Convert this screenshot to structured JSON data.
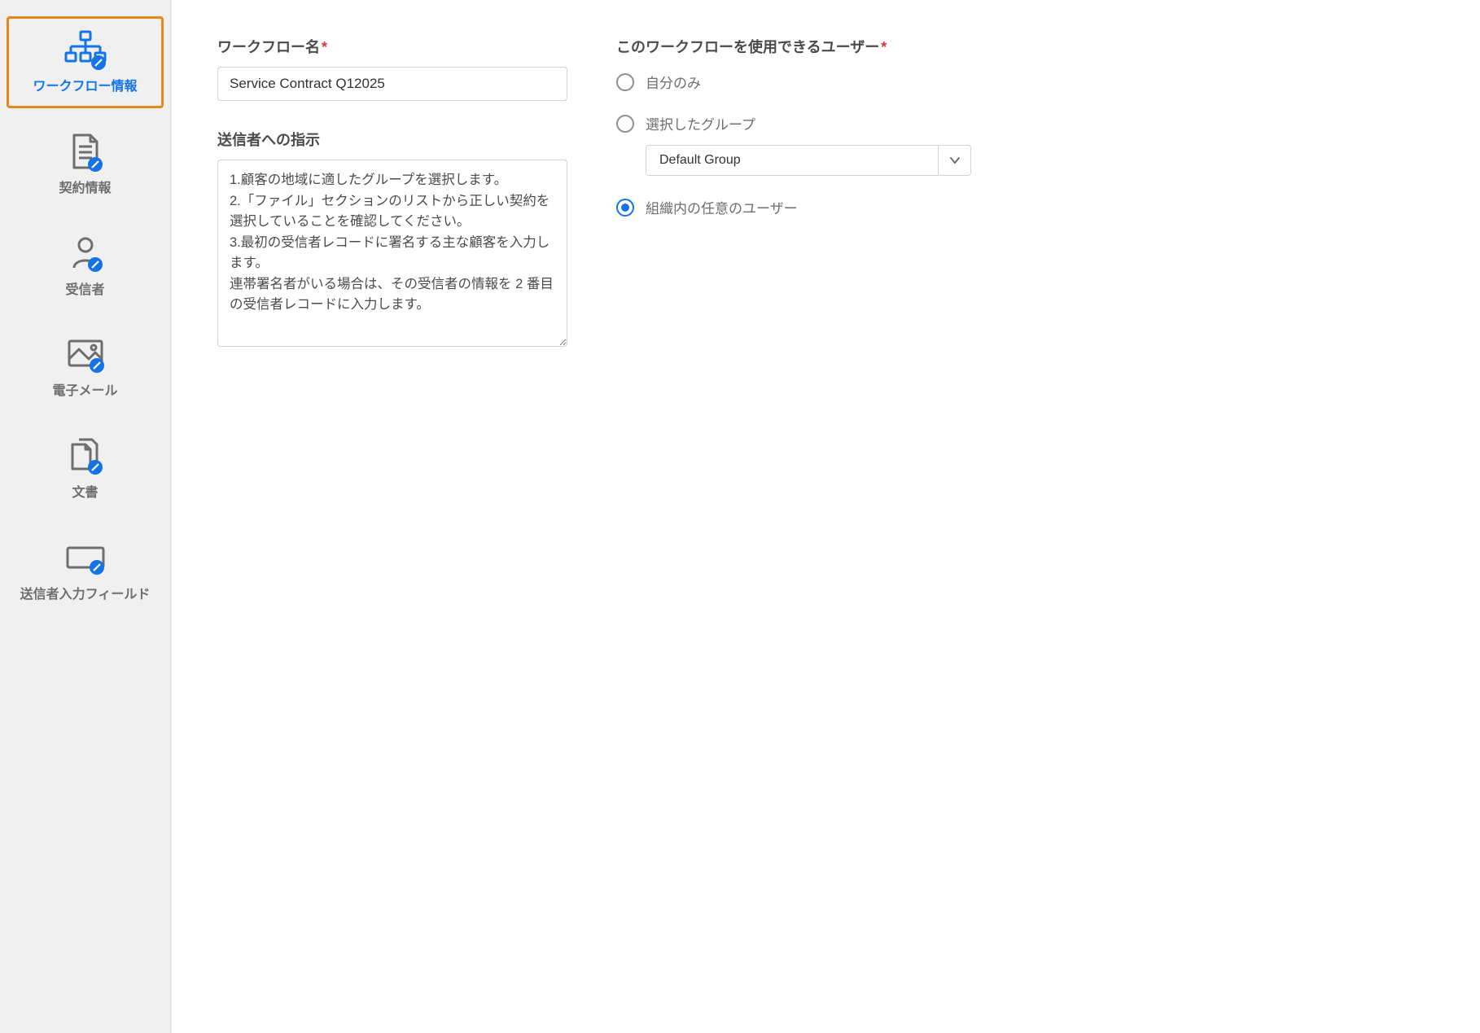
{
  "sidebar": {
    "items": [
      {
        "label": "ワークフロー情報"
      },
      {
        "label": "契約情報"
      },
      {
        "label": "受信者"
      },
      {
        "label": "電子メール"
      },
      {
        "label": "文書"
      },
      {
        "label": "送信者入力フィールド"
      }
    ]
  },
  "form": {
    "workflow_name_label": "ワークフロー名",
    "workflow_name_value": "Service Contract Q12025",
    "instructions_label": "送信者への指示",
    "instructions_value": "1.顧客の地域に適したグループを選択します。\n2.「ファイル」セクションのリストから正しい契約を選択していることを確認してください。\n3.最初の受信者レコードに署名する主な顧客を入力します。\n連帯署名者がいる場合は、その受信者の情報を 2 番目の受信者レコードに入力します。"
  },
  "access": {
    "section_label": "このワークフローを使用できるユーザー",
    "option_self": "自分のみ",
    "option_group": "選択したグループ",
    "option_group_value": "Default Group",
    "option_anyone": "組織内の任意のユーザー"
  }
}
